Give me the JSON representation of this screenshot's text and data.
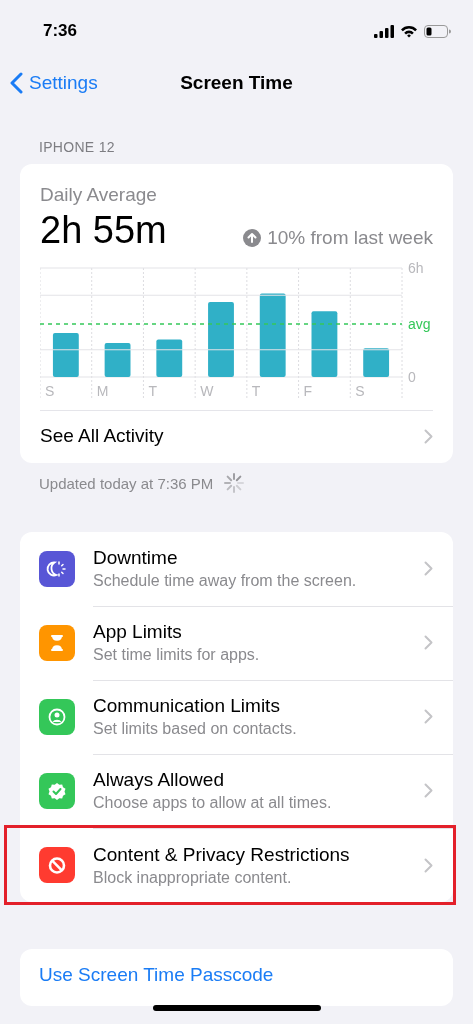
{
  "status_bar": {
    "time": "7:36"
  },
  "nav": {
    "back": "Settings",
    "title": "Screen Time"
  },
  "section_header": "IPHONE 12",
  "usage": {
    "label": "Daily Average",
    "total": "2h 55m",
    "change": "10% from last week",
    "increase": true,
    "chart_data": {
      "type": "bar",
      "categories": [
        "S",
        "M",
        "T",
        "W",
        "T",
        "F",
        "S"
      ],
      "values": [
        2.42,
        1.87,
        2.07,
        4.13,
        4.6,
        3.62,
        1.58
      ],
      "ylim": [
        0,
        6
      ],
      "yticks": [
        {
          "value": 0,
          "label": "0"
        },
        {
          "value": 6,
          "label": "6h"
        }
      ],
      "ref_lines": [
        {
          "axis": "y",
          "value": 1.5,
          "color": "#e3e3e7"
        },
        {
          "axis": "y",
          "value": 2.92,
          "label": "avg",
          "color": "#34c759"
        },
        {
          "axis": "y",
          "value": 4.5,
          "color": "#e3e3e7"
        }
      ]
    },
    "link": "See All Activity"
  },
  "updated": "Updated today at 7:36 PM",
  "items": [
    {
      "kind": "downtime",
      "title": "Downtime",
      "subtitle": "Schedule time away from the screen.",
      "color": "#5856d6",
      "highlighted": false
    },
    {
      "kind": "app-limits",
      "title": "App Limits",
      "subtitle": "Set time limits for apps.",
      "color": "#ff9500",
      "highlighted": false
    },
    {
      "kind": "communication",
      "title": "Communication Limits",
      "subtitle": "Set limits based on contacts.",
      "color": "#34c759",
      "highlighted": false
    },
    {
      "kind": "always-allowed",
      "title": "Always Allowed",
      "subtitle": "Choose apps to allow at all times.",
      "color": "#34c759",
      "highlighted": false
    },
    {
      "kind": "restrictions",
      "title": "Content & Privacy Restrictions",
      "subtitle": "Block inappropriate content.",
      "color": "#ff3b30",
      "highlighted": true
    }
  ],
  "passcode": "Use Screen Time Passcode"
}
